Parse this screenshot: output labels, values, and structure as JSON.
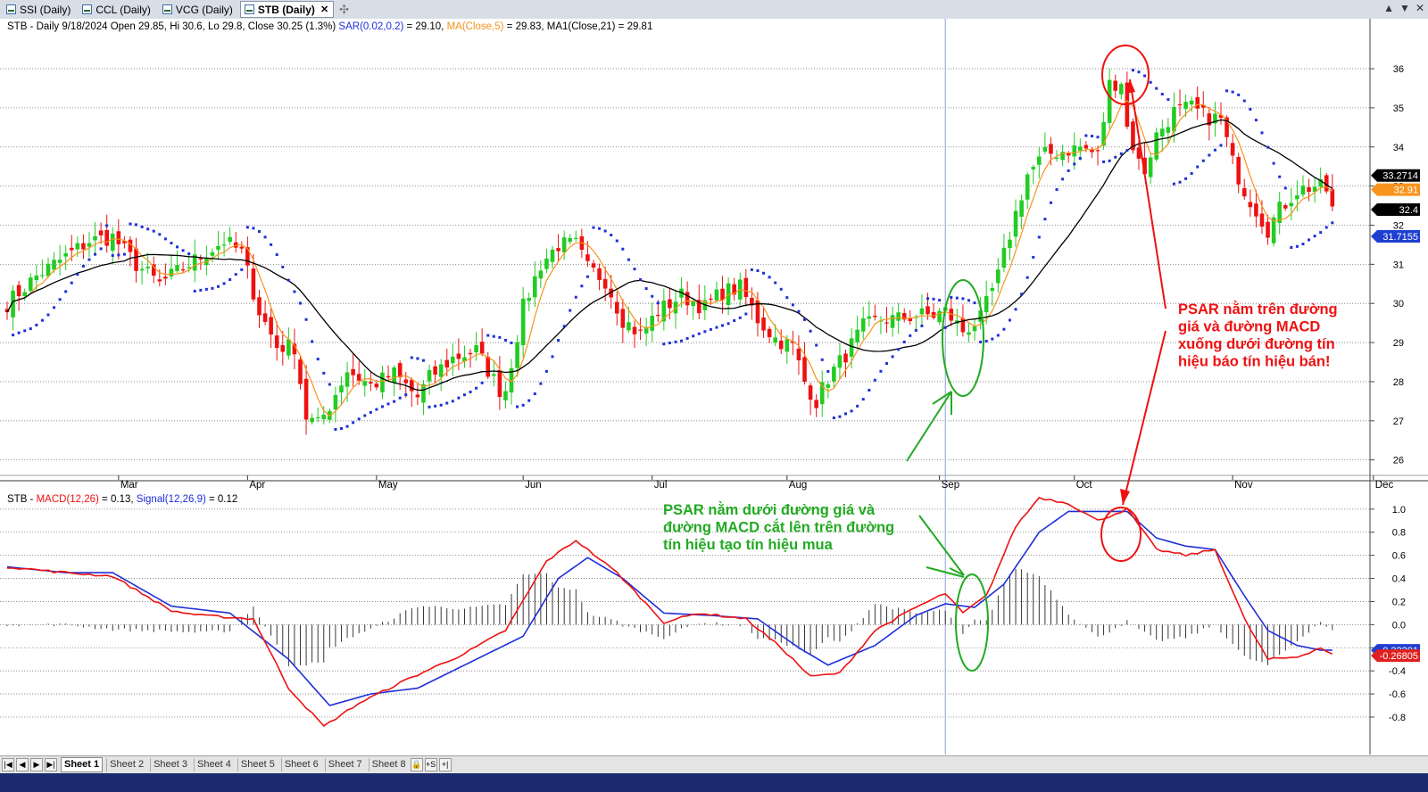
{
  "tabs": [
    {
      "label": "SSI (Daily)",
      "active": false
    },
    {
      "label": "CCL (Daily)",
      "active": false
    },
    {
      "label": "VCG (Daily)",
      "active": false
    },
    {
      "label": "STB (Daily)",
      "active": true
    }
  ],
  "tab_close_glyph": "✕",
  "new_tab_glyph": "✣",
  "window_buttons": [
    "▲",
    "▼",
    "✕"
  ],
  "price_pane": {
    "header": {
      "part1": "STB - Daily 9/18/2024 Open 29.85, Hi 30.6, Lo 29.8, Close 30.25 (1.3%) ",
      "sar": "SAR(0.02,0.2)",
      "sar_val": " = 29.10, ",
      "ma": "MA(Close,5)",
      "ma_val": " = 29.83, ",
      "ma1": "MA1(Close,21) = 29.81"
    },
    "right_labels": [
      {
        "text": "33.2714",
        "value": 33.2714,
        "bg": "#000000",
        "fg": "#ffffff"
      },
      {
        "text": "32.91",
        "value": 32.91,
        "bg": "#f7941d",
        "fg": "#ffffff"
      },
      {
        "text": "32.4",
        "value": 32.4,
        "bg": "#000000",
        "fg": "#ffffff"
      },
      {
        "text": "31.7155",
        "value": 31.7155,
        "bg": "#1f3fd0",
        "fg": "#ffffff"
      }
    ]
  },
  "macd_pane": {
    "header": {
      "part1": "STB - ",
      "macd": "MACD(12,26)",
      "macd_val": " = 0.13, ",
      "signal": "Signal(12,26,9)",
      "signal_val": " = 0.12"
    },
    "right_labels": [
      {
        "text": "-0.22201",
        "value": -0.222,
        "bg": "#1f3fd0",
        "fg": "#ffffff"
      },
      {
        "text": "-0.26805",
        "value": -0.268,
        "bg": "#e02020",
        "fg": "#ffffff"
      }
    ]
  },
  "annotations": {
    "sell_text": [
      "PSAR nằm trên đường",
      "giá và đường MACD",
      "xuống dưới đường tín",
      "hiệu báo tín hiệu bán!"
    ],
    "buy_text": [
      "PSAR nằm dưới đường giá và",
      "đường MACD cắt lên trên đường",
      "tín hiệu tạo tín hiệu mua"
    ]
  },
  "sheets": [
    "Sheet 1",
    "Sheet 2",
    "Sheet 3",
    "Sheet 4",
    "Sheet 5",
    "Sheet 6",
    "Sheet 7",
    "Sheet 8"
  ],
  "sheet_nav": [
    "|◀",
    "◀",
    "▶",
    "▶|"
  ],
  "sheet_tools": [
    "🔒",
    "+S",
    "+|"
  ],
  "colors": {
    "up": "#22cc22",
    "down": "#ee1111",
    "sar": "#1f2fd8",
    "ma5": "#f7941d",
    "ma21": "#000000",
    "macd": "#ee1111",
    "signal": "#1f2fd8",
    "annot_red": "#ee1111",
    "annot_green": "#22aa22"
  },
  "chart_data": [
    {
      "type": "candlestick",
      "title": "STB - Daily",
      "x_ticks": [
        "Mar",
        "Apr",
        "May",
        "Jun",
        "Jul",
        "Aug",
        "Sep",
        "Oct",
        "Nov",
        "Dec"
      ],
      "x_tick_index": [
        19,
        41,
        63,
        88,
        110,
        133,
        159,
        182,
        209,
        233
      ],
      "y_ticks": [
        26,
        27,
        28,
        29,
        30,
        31,
        32,
        33,
        34,
        35,
        36
      ],
      "ylim": [
        25.65,
        37.05
      ],
      "grid": true,
      "close_knots": [
        [
          0,
          30.0
        ],
        [
          5,
          30.7
        ],
        [
          10,
          31.2
        ],
        [
          14,
          31.6
        ],
        [
          18,
          31.7
        ],
        [
          22,
          31.0
        ],
        [
          26,
          30.5
        ],
        [
          30,
          30.9
        ],
        [
          33,
          31.2
        ],
        [
          37,
          31.6
        ],
        [
          40,
          31.3
        ],
        [
          43,
          29.8
        ],
        [
          46,
          28.9
        ],
        [
          49,
          28.9
        ],
        [
          51,
          27.1
        ],
        [
          53,
          26.9
        ],
        [
          55,
          27.4
        ],
        [
          58,
          28.3
        ],
        [
          62,
          27.9
        ],
        [
          66,
          28.2
        ],
        [
          70,
          27.6
        ],
        [
          72,
          28.1
        ],
        [
          76,
          28.6
        ],
        [
          80,
          28.8
        ],
        [
          84,
          27.8
        ],
        [
          85,
          27.8
        ],
        [
          88,
          29.9
        ],
        [
          91,
          31.0
        ],
        [
          94,
          31.5
        ],
        [
          97,
          31.5
        ],
        [
          99,
          30.9
        ],
        [
          102,
          30.6
        ],
        [
          105,
          29.6
        ],
        [
          108,
          29.2
        ],
        [
          111,
          29.8
        ],
        [
          115,
          30.2
        ],
        [
          119,
          29.9
        ],
        [
          122,
          30.3
        ],
        [
          125,
          30.4
        ],
        [
          128,
          29.6
        ],
        [
          131,
          29.1
        ],
        [
          134,
          28.9
        ],
        [
          136,
          28.0
        ],
        [
          138,
          27.5
        ],
        [
          140,
          28.1
        ],
        [
          143,
          28.7
        ],
        [
          146,
          29.4
        ],
        [
          149,
          29.6
        ],
        [
          152,
          29.6
        ],
        [
          155,
          29.7
        ],
        [
          158,
          29.7
        ],
        [
          160,
          29.8
        ],
        [
          163,
          29.3
        ],
        [
          166,
          29.6
        ],
        [
          169,
          30.7
        ],
        [
          172,
          32.3
        ],
        [
          174,
          33.3
        ],
        [
          177,
          33.8
        ],
        [
          180,
          33.9
        ],
        [
          183,
          34.0
        ],
        [
          186,
          33.8
        ],
        [
          188,
          35.6
        ],
        [
          190,
          35.7
        ],
        [
          191,
          34.5
        ],
        [
          193,
          33.6
        ],
        [
          194,
          33.4
        ],
        [
          196,
          34.3
        ],
        [
          199,
          34.9
        ],
        [
          202,
          35.0
        ],
        [
          204,
          34.8
        ],
        [
          207,
          34.7
        ],
        [
          209,
          33.6
        ],
        [
          211,
          32.9
        ],
        [
          213,
          32.4
        ],
        [
          215,
          31.9
        ],
        [
          217,
          32.4
        ],
        [
          220,
          32.9
        ],
        [
          223,
          33.0
        ],
        [
          225,
          32.9
        ],
        [
          226,
          32.4
        ]
      ],
      "open": [
        29.85
      ],
      "high": [
        30.6
      ],
      "low": [
        29.8
      ],
      "close": [
        30.25
      ]
    },
    {
      "type": "line",
      "title": "STB - MACD(12,26)",
      "y_ticks": [
        -0.8,
        -0.6,
        -0.4,
        -0.2,
        0.0,
        0.2,
        0.4,
        0.6,
        0.8,
        1.0
      ],
      "ylim": [
        -0.97,
        1.13
      ],
      "series": [
        {
          "name": "MACD(12,26)",
          "knots": [
            [
              0,
              0.5
            ],
            [
              10,
              0.45
            ],
            [
              18,
              0.42
            ],
            [
              28,
              0.12
            ],
            [
              33,
              0.08
            ],
            [
              42,
              0.05
            ],
            [
              48,
              -0.55
            ],
            [
              54,
              -0.88
            ],
            [
              60,
              -0.68
            ],
            [
              68,
              -0.48
            ],
            [
              78,
              -0.25
            ],
            [
              85,
              -0.05
            ],
            [
              92,
              0.55
            ],
            [
              97,
              0.73
            ],
            [
              104,
              0.45
            ],
            [
              112,
              0.02
            ],
            [
              118,
              0.1
            ],
            [
              126,
              0.05
            ],
            [
              132,
              -0.2
            ],
            [
              137,
              -0.45
            ],
            [
              142,
              -0.42
            ],
            [
              148,
              -0.05
            ],
            [
              155,
              0.15
            ],
            [
              160,
              0.27
            ],
            [
              163,
              0.1
            ],
            [
              167,
              0.25
            ],
            [
              172,
              0.85
            ],
            [
              176,
              1.1
            ],
            [
              181,
              1.05
            ],
            [
              186,
              0.9
            ],
            [
              191,
              1.0
            ],
            [
              196,
              0.65
            ],
            [
              201,
              0.6
            ],
            [
              206,
              0.65
            ],
            [
              211,
              0.05
            ],
            [
              215,
              -0.3
            ],
            [
              220,
              -0.28
            ],
            [
              224,
              -0.2
            ],
            [
              226,
              -0.26
            ]
          ]
        },
        {
          "name": "Signal(12,26,9)",
          "knots": [
            [
              0,
              0.5
            ],
            [
              10,
              0.45
            ],
            [
              18,
              0.45
            ],
            [
              28,
              0.16
            ],
            [
              38,
              0.1
            ],
            [
              48,
              -0.3
            ],
            [
              55,
              -0.7
            ],
            [
              62,
              -0.6
            ],
            [
              70,
              -0.55
            ],
            [
              80,
              -0.3
            ],
            [
              88,
              -0.1
            ],
            [
              94,
              0.4
            ],
            [
              99,
              0.58
            ],
            [
              105,
              0.4
            ],
            [
              112,
              0.1
            ],
            [
              120,
              0.08
            ],
            [
              128,
              0.05
            ],
            [
              135,
              -0.2
            ],
            [
              140,
              -0.35
            ],
            [
              148,
              -0.18
            ],
            [
              155,
              0.08
            ],
            [
              160,
              0.18
            ],
            [
              165,
              0.15
            ],
            [
              170,
              0.35
            ],
            [
              176,
              0.8
            ],
            [
              181,
              0.98
            ],
            [
              186,
              0.98
            ],
            [
              191,
              0.98
            ],
            [
              196,
              0.75
            ],
            [
              201,
              0.68
            ],
            [
              206,
              0.65
            ],
            [
              211,
              0.25
            ],
            [
              215,
              -0.05
            ],
            [
              220,
              -0.18
            ],
            [
              224,
              -0.22
            ],
            [
              226,
              -0.22
            ]
          ]
        }
      ]
    }
  ]
}
